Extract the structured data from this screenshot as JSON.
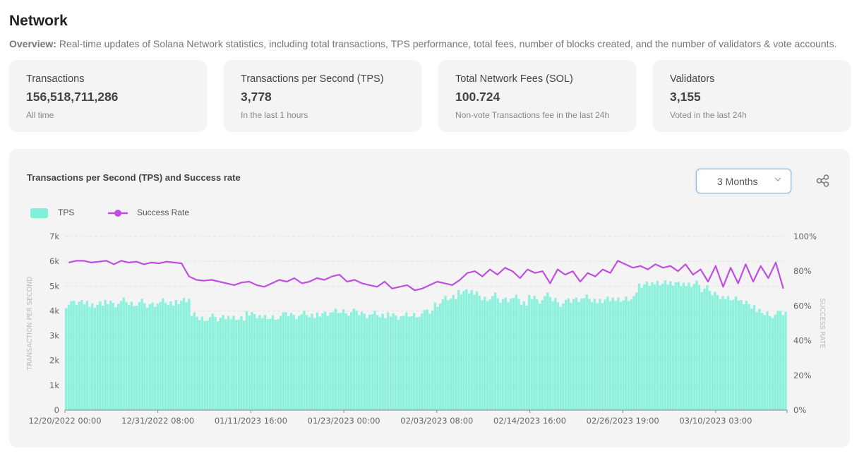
{
  "header": {
    "title": "Network",
    "overview_label": "Overview:",
    "overview_text": " Real-time updates of Solana Network statistics, including total transactions, TPS performance, total fees, number of blocks created, and the number of validators & vote accounts."
  },
  "cards": [
    {
      "label": "Transactions",
      "value": "156,518,711,286",
      "sub": "All time"
    },
    {
      "label": "Transactions per Second (TPS)",
      "value": "3,778",
      "sub": "In the last 1 hours"
    },
    {
      "label": "Total Network Fees (SOL)",
      "value": "100.724",
      "sub": "Non-vote Transactions fee in the last 24h"
    },
    {
      "label": "Validators",
      "value": "3,155",
      "sub": "Voted in the last 24h"
    }
  ],
  "controls": {
    "range_selected": "3 Months",
    "share_icon": "share-icon"
  },
  "colors": {
    "tps": "#7ff0d9",
    "success_rate": "#c04ee0"
  },
  "chart_data": {
    "type": "bar",
    "title": "Transactions per Second (TPS) and Success rate",
    "legend": [
      "TPS",
      "Success Rate"
    ],
    "legend_position": "top-left",
    "ylabel_left": "TRANSACTION PER SECOND",
    "ylabel_right": "SUCCESS RATE",
    "ylim_left": [
      0,
      7000
    ],
    "ylim_right": [
      0,
      100
    ],
    "yticks_left": [
      "0",
      "1k",
      "2k",
      "3k",
      "4k",
      "5k",
      "6k",
      "7k"
    ],
    "yticks_right": [
      "0%",
      "20%",
      "40%",
      "60%",
      "80%",
      "100%"
    ],
    "grid": true,
    "x_start": "12/20/2022 00:00",
    "x_end": "03/18/2023 00:00",
    "xticks": [
      "12/20/2022 00:00",
      "12/31/2022 08:00",
      "01/11/2023 16:00",
      "01/23/2023 00:00",
      "02/03/2023 08:00",
      "02/14/2023 16:00",
      "02/26/2023 19:00",
      "03/10/2023 03:00"
    ],
    "series": [
      {
        "name": "TPS",
        "type": "bar",
        "axis": "left",
        "values": [
          4250,
          4300,
          4400,
          4200,
          4350,
          4300,
          4250,
          4400,
          4300,
          4350,
          4200,
          4300,
          4400,
          4350,
          4300,
          4450,
          3800,
          3700,
          3750,
          3650,
          3800,
          3700,
          3750,
          3850,
          3800,
          3700,
          3750,
          3800,
          3850,
          3800,
          3900,
          3850,
          3800,
          3900,
          3950,
          4000,
          3950,
          3900,
          3850,
          3900,
          3850,
          3800,
          3750,
          3800,
          3850,
          3900,
          3950,
          4300,
          4500,
          4600,
          4700,
          4800,
          4650,
          4500,
          4600,
          4400,
          4500,
          4550,
          4350,
          4500,
          4400,
          4600,
          4450,
          4300,
          4400,
          4500,
          4550,
          4450,
          4350,
          4500,
          4400,
          4500,
          4600,
          5000,
          5150,
          5100,
          5200,
          5050,
          5100,
          5000,
          5150,
          4900,
          4700,
          4600,
          4500,
          4550,
          4300,
          4200,
          3950,
          3900,
          3850,
          3900
        ]
      },
      {
        "name": "Success Rate",
        "type": "line",
        "axis": "right",
        "values": [
          85,
          86,
          86,
          85,
          85.5,
          86,
          84,
          86,
          85,
          85.5,
          84,
          85,
          84.5,
          85.5,
          85,
          84.5,
          77,
          75,
          74.5,
          75,
          74,
          73,
          72,
          73.5,
          74,
          72,
          71,
          73,
          75,
          74,
          76,
          73,
          74,
          76,
          75,
          77,
          78,
          74,
          75,
          73,
          72,
          71,
          74,
          70,
          71,
          72,
          69,
          70,
          72,
          74,
          73,
          72,
          75,
          79,
          80,
          77,
          81,
          78,
          82,
          80,
          76,
          81,
          79,
          80,
          73,
          81,
          78,
          80,
          74,
          79,
          77,
          81,
          79,
          86,
          84,
          82,
          83,
          81,
          84,
          82,
          83,
          80,
          84,
          78,
          81,
          74,
          83,
          71,
          82,
          73,
          84,
          74,
          83,
          76,
          85,
          70
        ]
      }
    ]
  }
}
